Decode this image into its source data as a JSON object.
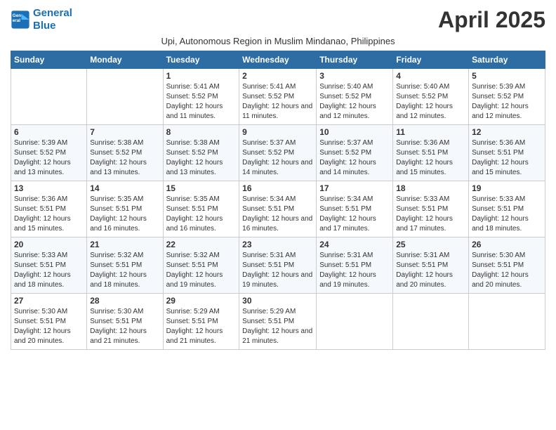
{
  "logo": {
    "line1": "General",
    "line2": "Blue"
  },
  "title": "April 2025",
  "subtitle": "Upi, Autonomous Region in Muslim Mindanao, Philippines",
  "headers": [
    "Sunday",
    "Monday",
    "Tuesday",
    "Wednesday",
    "Thursday",
    "Friday",
    "Saturday"
  ],
  "weeks": [
    [
      {
        "day": "",
        "info": ""
      },
      {
        "day": "",
        "info": ""
      },
      {
        "day": "1",
        "info": "Sunrise: 5:41 AM\nSunset: 5:52 PM\nDaylight: 12 hours and 11 minutes."
      },
      {
        "day": "2",
        "info": "Sunrise: 5:41 AM\nSunset: 5:52 PM\nDaylight: 12 hours and 11 minutes."
      },
      {
        "day": "3",
        "info": "Sunrise: 5:40 AM\nSunset: 5:52 PM\nDaylight: 12 hours and 12 minutes."
      },
      {
        "day": "4",
        "info": "Sunrise: 5:40 AM\nSunset: 5:52 PM\nDaylight: 12 hours and 12 minutes."
      },
      {
        "day": "5",
        "info": "Sunrise: 5:39 AM\nSunset: 5:52 PM\nDaylight: 12 hours and 12 minutes."
      }
    ],
    [
      {
        "day": "6",
        "info": "Sunrise: 5:39 AM\nSunset: 5:52 PM\nDaylight: 12 hours and 13 minutes."
      },
      {
        "day": "7",
        "info": "Sunrise: 5:38 AM\nSunset: 5:52 PM\nDaylight: 12 hours and 13 minutes."
      },
      {
        "day": "8",
        "info": "Sunrise: 5:38 AM\nSunset: 5:52 PM\nDaylight: 12 hours and 13 minutes."
      },
      {
        "day": "9",
        "info": "Sunrise: 5:37 AM\nSunset: 5:52 PM\nDaylight: 12 hours and 14 minutes."
      },
      {
        "day": "10",
        "info": "Sunrise: 5:37 AM\nSunset: 5:52 PM\nDaylight: 12 hours and 14 minutes."
      },
      {
        "day": "11",
        "info": "Sunrise: 5:36 AM\nSunset: 5:51 PM\nDaylight: 12 hours and 15 minutes."
      },
      {
        "day": "12",
        "info": "Sunrise: 5:36 AM\nSunset: 5:51 PM\nDaylight: 12 hours and 15 minutes."
      }
    ],
    [
      {
        "day": "13",
        "info": "Sunrise: 5:36 AM\nSunset: 5:51 PM\nDaylight: 12 hours and 15 minutes."
      },
      {
        "day": "14",
        "info": "Sunrise: 5:35 AM\nSunset: 5:51 PM\nDaylight: 12 hours and 16 minutes."
      },
      {
        "day": "15",
        "info": "Sunrise: 5:35 AM\nSunset: 5:51 PM\nDaylight: 12 hours and 16 minutes."
      },
      {
        "day": "16",
        "info": "Sunrise: 5:34 AM\nSunset: 5:51 PM\nDaylight: 12 hours and 16 minutes."
      },
      {
        "day": "17",
        "info": "Sunrise: 5:34 AM\nSunset: 5:51 PM\nDaylight: 12 hours and 17 minutes."
      },
      {
        "day": "18",
        "info": "Sunrise: 5:33 AM\nSunset: 5:51 PM\nDaylight: 12 hours and 17 minutes."
      },
      {
        "day": "19",
        "info": "Sunrise: 5:33 AM\nSunset: 5:51 PM\nDaylight: 12 hours and 18 minutes."
      }
    ],
    [
      {
        "day": "20",
        "info": "Sunrise: 5:33 AM\nSunset: 5:51 PM\nDaylight: 12 hours and 18 minutes."
      },
      {
        "day": "21",
        "info": "Sunrise: 5:32 AM\nSunset: 5:51 PM\nDaylight: 12 hours and 18 minutes."
      },
      {
        "day": "22",
        "info": "Sunrise: 5:32 AM\nSunset: 5:51 PM\nDaylight: 12 hours and 19 minutes."
      },
      {
        "day": "23",
        "info": "Sunrise: 5:31 AM\nSunset: 5:51 PM\nDaylight: 12 hours and 19 minutes."
      },
      {
        "day": "24",
        "info": "Sunrise: 5:31 AM\nSunset: 5:51 PM\nDaylight: 12 hours and 19 minutes."
      },
      {
        "day": "25",
        "info": "Sunrise: 5:31 AM\nSunset: 5:51 PM\nDaylight: 12 hours and 20 minutes."
      },
      {
        "day": "26",
        "info": "Sunrise: 5:30 AM\nSunset: 5:51 PM\nDaylight: 12 hours and 20 minutes."
      }
    ],
    [
      {
        "day": "27",
        "info": "Sunrise: 5:30 AM\nSunset: 5:51 PM\nDaylight: 12 hours and 20 minutes."
      },
      {
        "day": "28",
        "info": "Sunrise: 5:30 AM\nSunset: 5:51 PM\nDaylight: 12 hours and 21 minutes."
      },
      {
        "day": "29",
        "info": "Sunrise: 5:29 AM\nSunset: 5:51 PM\nDaylight: 12 hours and 21 minutes."
      },
      {
        "day": "30",
        "info": "Sunrise: 5:29 AM\nSunset: 5:51 PM\nDaylight: 12 hours and 21 minutes."
      },
      {
        "day": "",
        "info": ""
      },
      {
        "day": "",
        "info": ""
      },
      {
        "day": "",
        "info": ""
      }
    ]
  ]
}
